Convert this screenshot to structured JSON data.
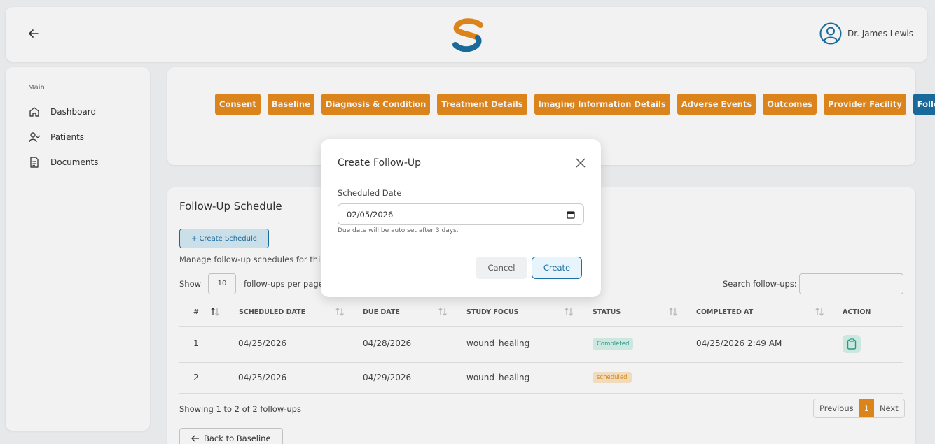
{
  "header": {
    "user_name": "Dr. James Lewis"
  },
  "sidebar": {
    "section": "Main",
    "items": [
      {
        "label": "Dashboard",
        "icon": "home-icon"
      },
      {
        "label": "Patients",
        "icon": "user-check-icon"
      },
      {
        "label": "Documents",
        "icon": "document-icon"
      }
    ]
  },
  "tabs": [
    "Consent",
    "Baseline",
    "Diagnosis & Condition",
    "Treatment Details",
    "Imaging Information Details",
    "Adverse Events",
    "Outcomes",
    "Provider Facility",
    "Follow-up"
  ],
  "active_tab": "Follow-up",
  "schedule": {
    "title": "Follow-Up Schedule",
    "create_button": "+ Create Schedule",
    "manage_text": "Manage follow-up schedules for this",
    "show_label": "Show",
    "show_value": "10",
    "per_page_label": "follow-ups per page",
    "search_label": "Search follow-ups:",
    "columns": [
      "#",
      "SCHEDULED DATE",
      "DUE DATE",
      "STUDY FOCUS",
      "STATUS",
      "COMPLETED AT",
      "ACTION"
    ],
    "rows": [
      {
        "num": "1",
        "scheduled": "04/25/2026",
        "due": "04/28/2026",
        "focus": "wound_healing",
        "status": "Completed",
        "completed_at": "04/25/2026 2:49 AM"
      },
      {
        "num": "2",
        "scheduled": "04/25/2026",
        "due": "04/29/2026",
        "focus": "wound_healing",
        "status": "scheduled",
        "completed_at": "—",
        "action": "—"
      }
    ],
    "showing_text": "Showing 1 to 2 of 2 follow-ups",
    "pager": {
      "previous": "Previous",
      "current": "1",
      "next": "Next"
    },
    "back_button": "Back to Baseline"
  },
  "modal": {
    "title": "Create Follow-Up",
    "date_label": "Scheduled Date",
    "date_value": "02/05/2026",
    "hint": "Due date will be auto set after 3 days.",
    "cancel": "Cancel",
    "create": "Create"
  },
  "colors": {
    "accent_orange": "#e88c1e",
    "accent_blue": "#1b6fa3"
  }
}
